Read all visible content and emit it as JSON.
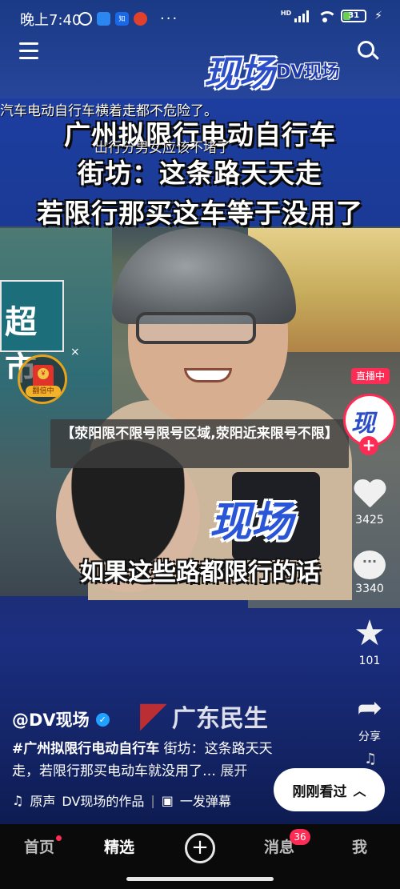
{
  "statusbar": {
    "time": "晚上7:40",
    "battery": "31",
    "network": "HD"
  },
  "video": {
    "logo_text": "DV现场",
    "logo_mark": "现场",
    "scroll_caption_1": "汽车电动自行车横着走都不危险了。",
    "scroll_caption_2": "出行分男女应该不堵了",
    "banner_line_1": "广州拟限行电动自行车",
    "banner_line_2": "街坊：这条路天天走",
    "banner_line_3": "若限行那买这车等于没用了",
    "store_sign": "超市",
    "subtitle": "如果这些路都限行的话",
    "watermark": "现场",
    "channel_logo": "广东民生"
  },
  "overlay_title": "【荥阳限不限号限号区域,荥阳近来限号不限】",
  "envelope": {
    "label": "翻倍中",
    "coin": "￥"
  },
  "rail": {
    "live_label": "直播中",
    "avatar_text": "现场",
    "likes": "3425",
    "comments": "3340",
    "favorites": "101",
    "share_label": "分享"
  },
  "post": {
    "author": "@DV现场",
    "hashtag": "#广州拟限行电动自行车",
    "text": " 街坊：这条路天天走，若限行那买电动车就没用了…",
    "more": " 展开",
    "music_icon_label": "原声",
    "music_name": "DV现场的作品",
    "danmu_label": "一发弹幕",
    "danmu_button": "刚刚看过"
  },
  "tabbar": {
    "home": "首页",
    "featured": "精选",
    "add": "+",
    "messages": "消息",
    "messages_badge": "36",
    "me": "我"
  }
}
